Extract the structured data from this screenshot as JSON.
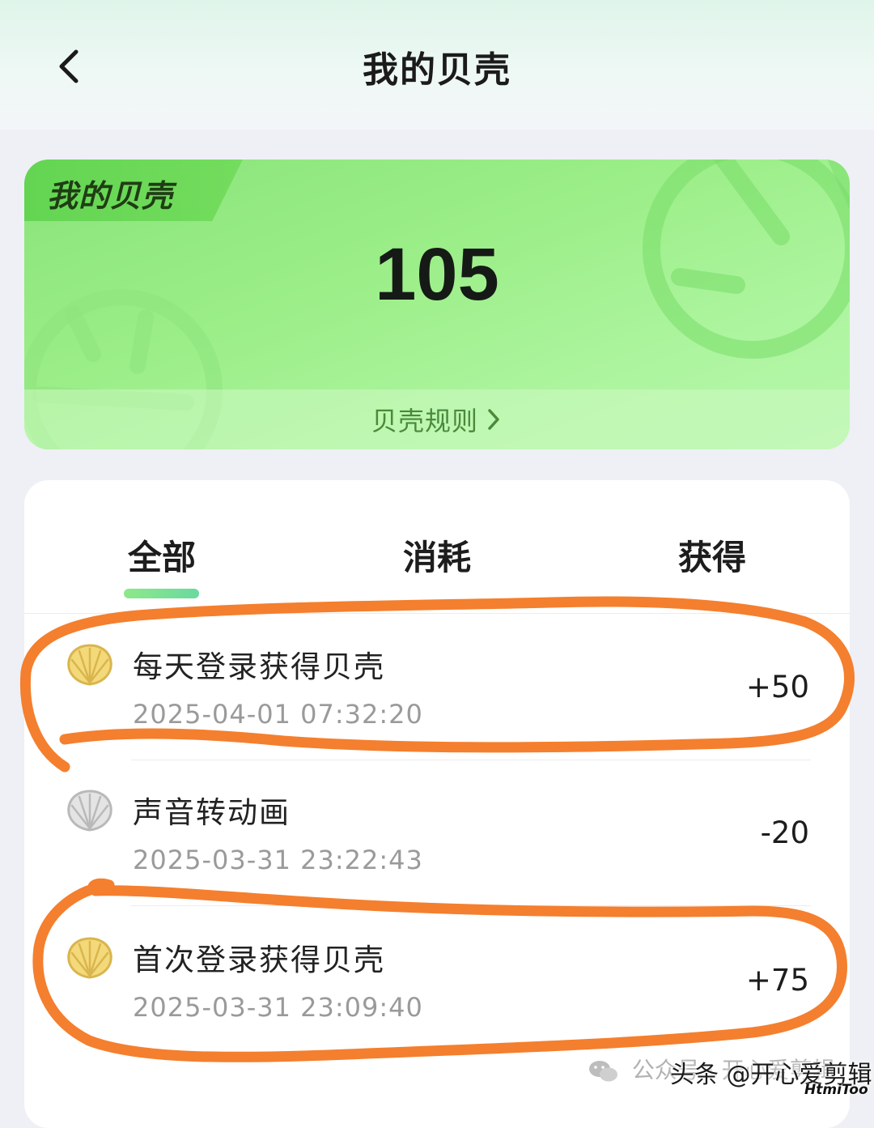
{
  "header": {
    "title": "我的贝壳",
    "back_icon": "chevron-left-icon"
  },
  "balance_card": {
    "tag": "我的贝壳",
    "balance": "105",
    "rules_link": "贝壳规则",
    "rules_icon": "chevron-right-icon",
    "colors": {
      "card": "#9bee88",
      "tag": "#63d552"
    }
  },
  "tabs": [
    {
      "label": "全部",
      "active": true
    },
    {
      "label": "消耗",
      "active": false
    },
    {
      "label": "获得",
      "active": false
    }
  ],
  "records": [
    {
      "title": "每天登录获得贝壳",
      "time": "2025-04-01 07:32:20",
      "amount": "+50",
      "icon": "shell-gold-icon",
      "circled": true
    },
    {
      "title": "声音转动画",
      "time": "2025-03-31 23:22:43",
      "amount": "-20",
      "icon": "shell-gray-icon",
      "circled": false
    },
    {
      "title": "首次登录获得贝壳",
      "time": "2025-03-31 23:09:40",
      "amount": "+75",
      "icon": "shell-gold-icon",
      "circled": true
    }
  ],
  "annotation_color": "#f47f2e",
  "watermark": {
    "faded": "公众号 · 开心爱剪辑",
    "main": "头条 @开心爱剪辑",
    "small": "HtmiToo",
    "icon": "wechat-icon"
  }
}
